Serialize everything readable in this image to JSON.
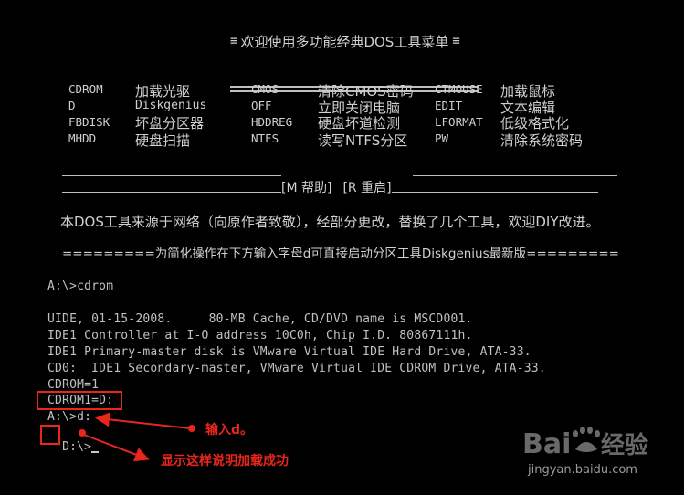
{
  "title": {
    "text": "欢迎使用多功能经典DOS工具菜单",
    "prefix_glyph": "≡",
    "suffix_glyph": "≡"
  },
  "menu": {
    "columns": [
      {
        "items": [
          {
            "cmd": "CDROM",
            "desc": "加载光驱"
          },
          {
            "cmd": "D",
            "desc": "Diskgenius"
          },
          {
            "cmd": "FBDISK",
            "desc": "坏盘分区器"
          },
          {
            "cmd": "MHDD",
            "desc": "硬盘扫描"
          }
        ]
      },
      {
        "items": [
          {
            "cmd": "CMOS",
            "desc": "清除CMOS密码"
          },
          {
            "cmd": "OFF",
            "desc": "立即关闭电脑"
          },
          {
            "cmd": "HDDREG",
            "desc": "硬盘坏道检测"
          },
          {
            "cmd": "NTFS",
            "desc": "读写NTFS分区"
          }
        ]
      },
      {
        "items": [
          {
            "cmd": "CTMOUSE",
            "desc": "加载鼠标"
          },
          {
            "cmd": "EDIT",
            "desc": "文本编辑"
          },
          {
            "cmd": "LFORMAT",
            "desc": "低级格式化"
          },
          {
            "cmd": "PW",
            "desc": "清除系统密码"
          }
        ]
      }
    ]
  },
  "help_bar": {
    "help": "[M 帮助]",
    "restart": "[R 重启]"
  },
  "intro": "本DOS工具来源于网络（向原作者致敬），经部分更改，替换了几个工具，欢迎DIY改进。",
  "tip": "=========为简化操作在下方输入字母d可直接启动分区工具Diskgenius最新版=========",
  "terminal": {
    "lines": [
      "A:\\>cdrom",
      "",
      "UIDE, 01-15-2008.     80-MB Cache, CD/DVD name is MSCD001.",
      "IDE1 Controller at I-O address 10C0h, Chip I.D. 80867111h.",
      "IDE1 Primary-master disk is VMware Virtual IDE Hard Drive, ATA-33.",
      "CD0:  IDE1 Secondary-master, VMware Virtual IDE CDROM Drive, ATA-33.",
      "CDROM=1",
      "CDROM1=D:",
      "A:\\>d:",
      "D:\\>"
    ]
  },
  "annotations": {
    "input_d": "输入d。",
    "success": "显示这样说明加载成功",
    "color": "#e8261c"
  },
  "watermark": {
    "logo_text": "Bai",
    "logo_text2": "经验",
    "url": "jingyan.baidu.com"
  }
}
